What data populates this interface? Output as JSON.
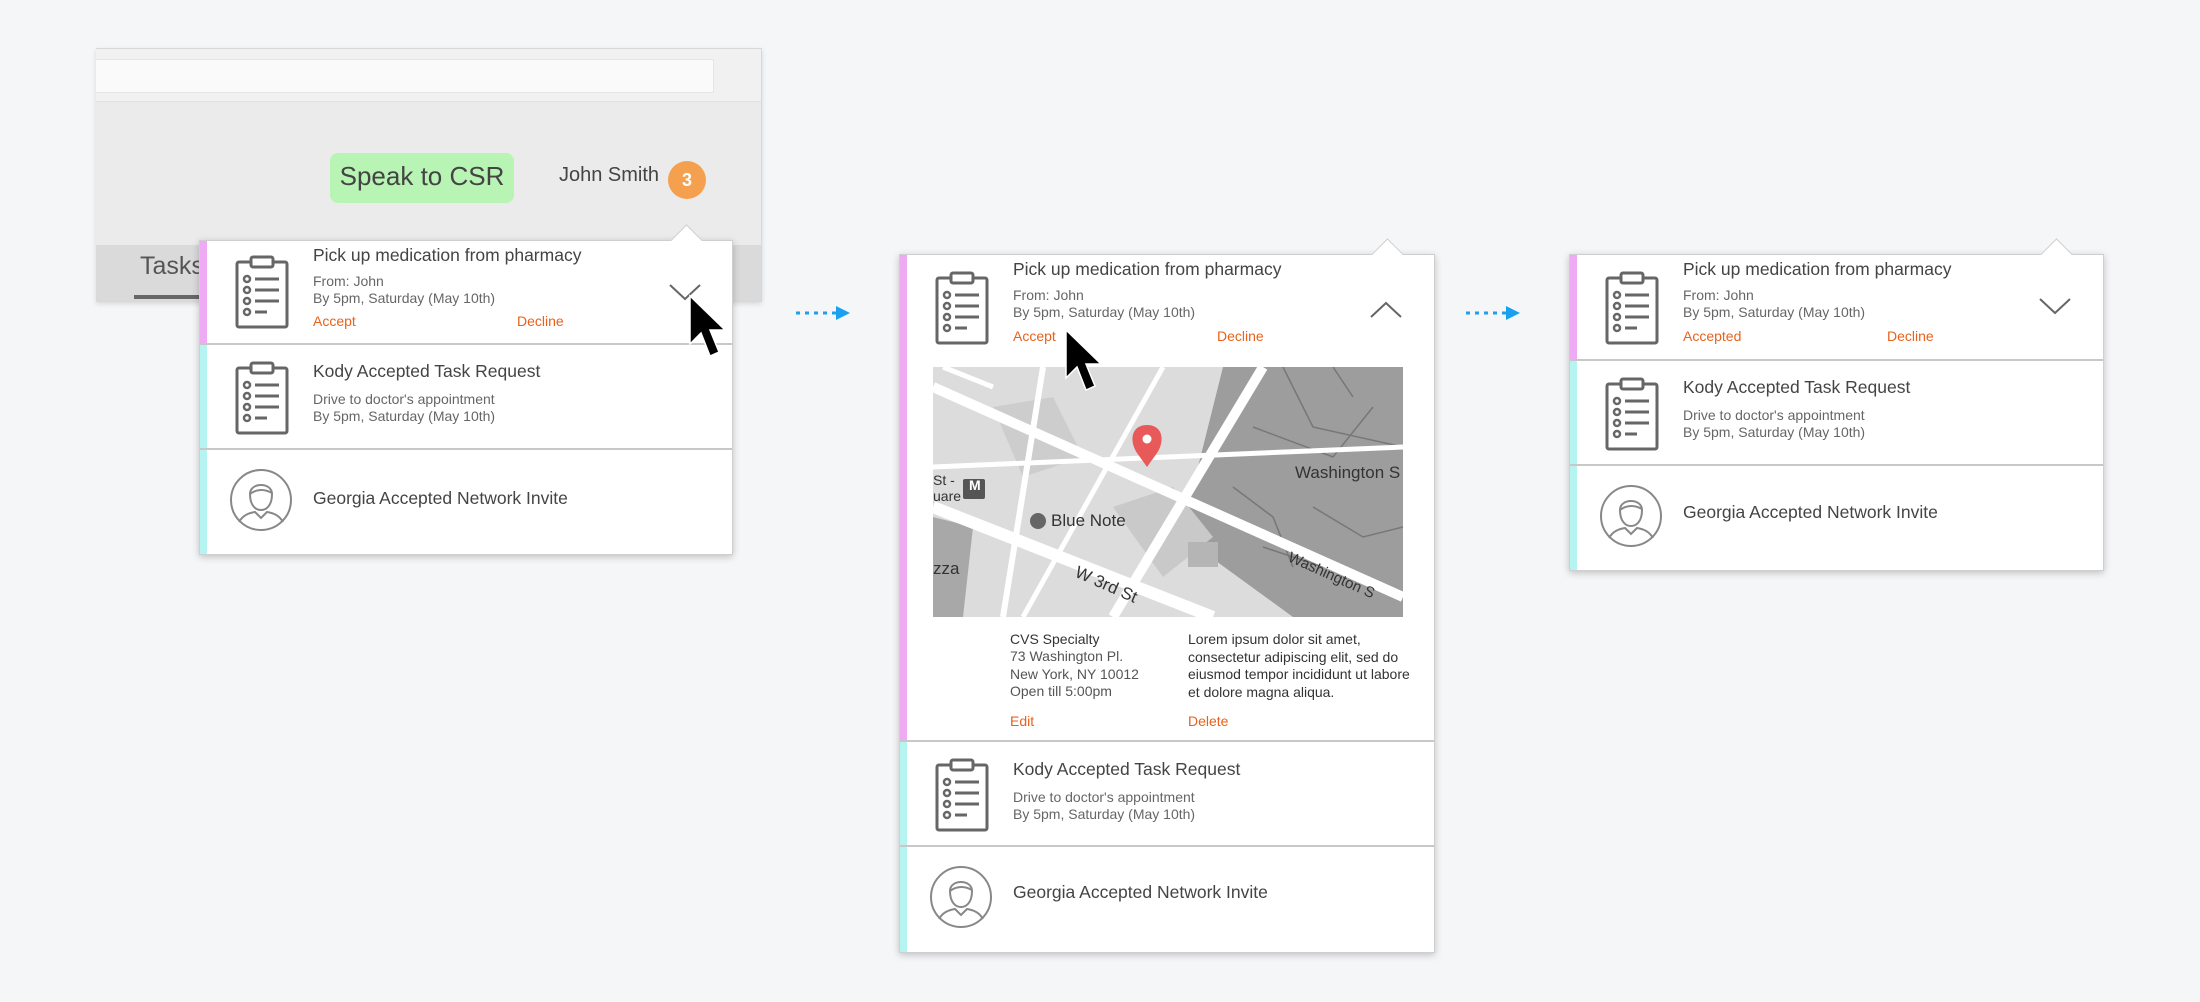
{
  "app": {
    "tab_label": "Tasks",
    "csr_button": "Speak to CSR",
    "user_name": "John Smith",
    "notification_count": "3"
  },
  "panels": [
    {
      "items": [
        {
          "title": "Pick up medication from pharmacy",
          "from": "From: John",
          "due": "By 5pm, Saturday (May 10th)",
          "accept": "Accept",
          "decline": "Decline"
        },
        {
          "title": "Kody Accepted Task Request",
          "detail": "Drive to doctor's appointment",
          "due": "By 5pm, Saturday (May 10th)"
        },
        {
          "title": "Georgia Accepted Network Invite"
        }
      ]
    },
    {
      "items": [
        {
          "title": "Pick up medication from pharmacy",
          "from": "From: John",
          "due": "By 5pm, Saturday (May 10th)",
          "accept": "Accept",
          "decline": "Decline"
        },
        {
          "title": "Kody Accepted Task Request",
          "detail": "Drive to doctor's appointment",
          "due": "By 5pm, Saturday (May 10th)"
        },
        {
          "title": "Georgia Accepted Network Invite"
        }
      ],
      "map": {
        "labels": {
          "blue_note": "Blue Note",
          "washington_sq": "Washington S",
          "washington_sq_south": "Washington S",
          "w3rd": "W 3rd St",
          "st_square": "St -\nuare",
          "plaza": "zza",
          "metro": "M"
        }
      },
      "location": {
        "name": "CVS Specialty",
        "address_line1": "73 Washington Pl.",
        "address_line2": "New York, NY 10012",
        "hours": "Open till 5:00pm"
      },
      "notes": "Lorem ipsum dolor sit amet, consectetur adipiscing elit, sed do eiusmod tempor incididunt ut labore et dolore magna aliqua.",
      "edit": "Edit",
      "delete": "Delete"
    },
    {
      "items": [
        {
          "title": "Pick up medication from pharmacy",
          "from": "From: John",
          "due": "By 5pm, Saturday (May 10th)",
          "accept": "Accepted",
          "decline": "Decline"
        },
        {
          "title": "Kody Accepted Task Request",
          "detail": "Drive to doctor's appointment",
          "due": "By 5pm, Saturday (May 10th)"
        },
        {
          "title": "Georgia Accepted Network Invite"
        }
      ]
    }
  ],
  "colors": {
    "action": "#e8621c",
    "badge": "#f5a04e",
    "csr_button": "#b8f4b4",
    "stripe_task": "#eeaaf2",
    "stripe_info": "#b6f4f2",
    "flow_arrow": "#1aa0f0",
    "map_pin": "#e85a5a"
  },
  "icons": [
    "clipboard-icon",
    "person-icon",
    "chevron-down-icon",
    "chevron-up-icon",
    "mouse-pointer-icon",
    "map-pin-icon",
    "metro-icon",
    "bar-icon"
  ]
}
